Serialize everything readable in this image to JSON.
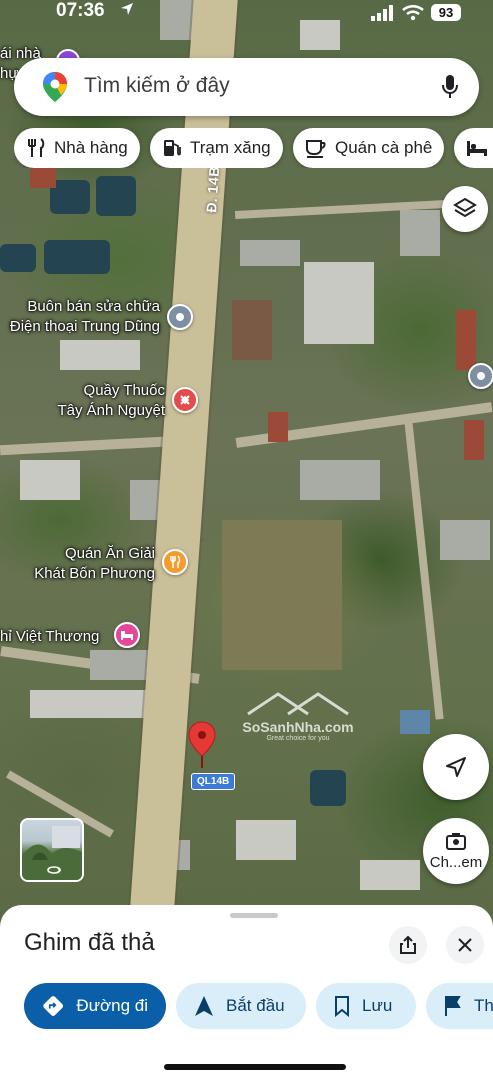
{
  "status_bar": {
    "time": "07:36",
    "battery": "93"
  },
  "search": {
    "placeholder": "Tìm kiếm ở đây"
  },
  "chips": [
    {
      "label": "Nhà hàng",
      "icon": "restaurant-icon"
    },
    {
      "label": "Trạm xăng",
      "icon": "gas-station-icon"
    },
    {
      "label": "Quán cà phê",
      "icon": "coffee-icon"
    },
    {
      "label": "",
      "icon": "hotel-icon"
    }
  ],
  "map": {
    "road_label": "Đ. 14B",
    "road_shield": "QL14B",
    "partial_top_label": "ái nhà",
    "partial_top_label2": "hự",
    "watermark_title": "SoSanhNha.com",
    "watermark_sub": "Great choice for you",
    "pois": [
      {
        "line1": "Buôn bán sửa chữa",
        "line2": "Điện thoại Trung Dũng",
        "icon": "pin-icon"
      },
      {
        "line1": "Quầy Thuốc",
        "line2": "Tây Ánh Nguyệt",
        "icon": "pharmacy-icon"
      },
      {
        "line1": "Quán Ăn Giải",
        "line2": "Khát Bốn Phương",
        "icon": "restaurant-icon"
      },
      {
        "line1": "hỉ Việt Thương",
        "line2": "",
        "icon": "hotel-icon"
      }
    ]
  },
  "controls": {
    "street_view_label": "Ch...em"
  },
  "sheet": {
    "title": "Ghim đã thả",
    "actions": [
      {
        "label": "Đường đi",
        "icon": "directions-icon"
      },
      {
        "label": "Bắt đầu",
        "icon": "navigation-arrow-icon"
      },
      {
        "label": "Lưu",
        "icon": "bookmark-icon"
      },
      {
        "label": "Th",
        "icon": "flag-icon"
      }
    ]
  },
  "colors": {
    "primary_blue": "#0b5fa9",
    "chip_blue_bg": "#d9eef9",
    "pin_red": "#e53935"
  }
}
